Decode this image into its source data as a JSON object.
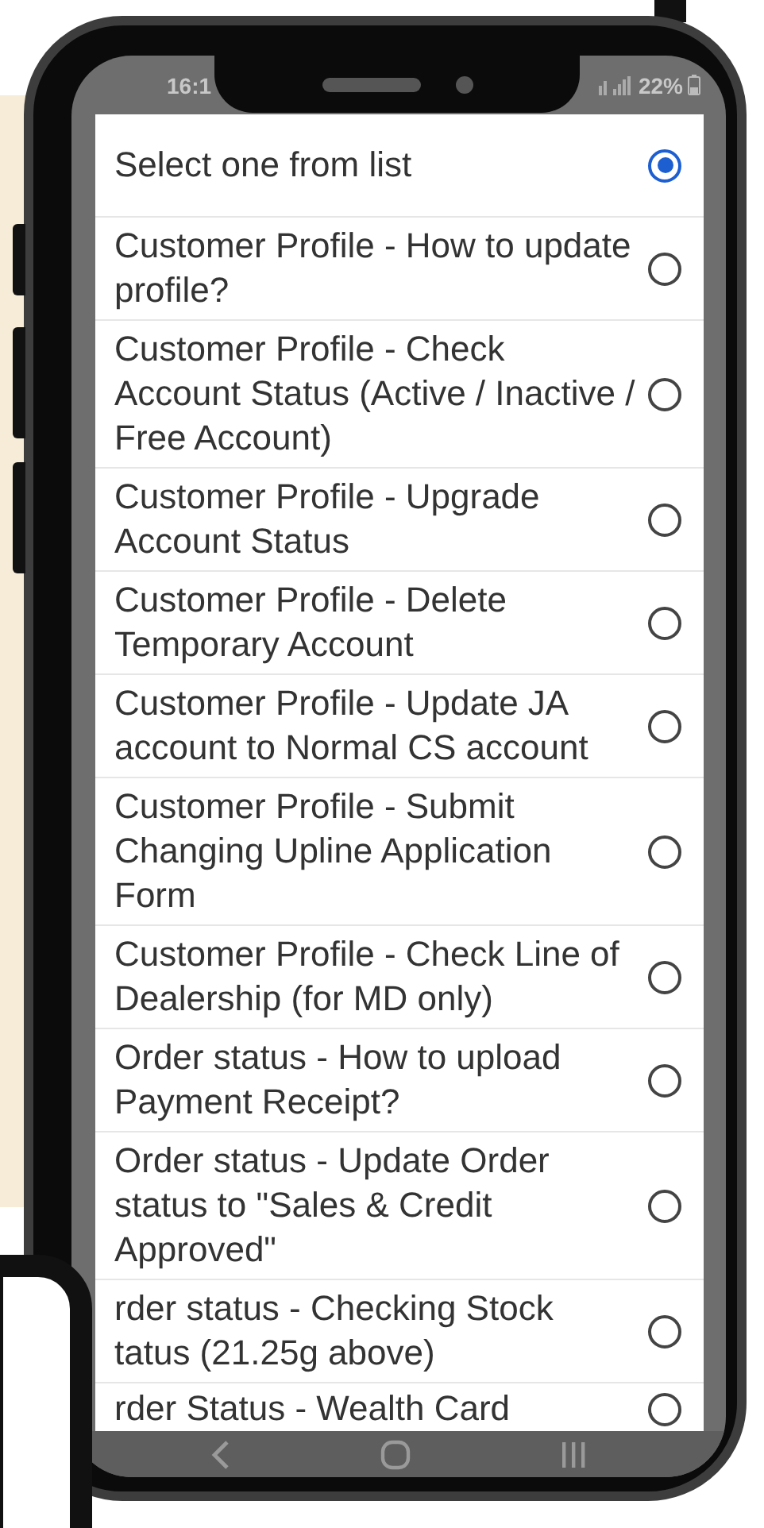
{
  "status_bar": {
    "time": "16:1",
    "battery": "22%"
  },
  "dialog": {
    "options": [
      {
        "label": "Select one from list",
        "selected": true
      },
      {
        "label": "Customer Profile - How to update profile?",
        "selected": false
      },
      {
        "label": "Customer Profile - Check Account Status (Active / Inactive / Free Account)",
        "selected": false
      },
      {
        "label": "Customer Profile - Upgrade Account Status",
        "selected": false
      },
      {
        "label": "Customer Profile - Delete Temporary Account",
        "selected": false
      },
      {
        "label": "Customer Profile - Update JA account to Normal CS account",
        "selected": false
      },
      {
        "label": "Customer Profile - Submit Changing Upline Application Form",
        "selected": false
      },
      {
        "label": "Customer Profile - Check Line of Dealership (for MD only)",
        "selected": false
      },
      {
        "label": "Order status - How to upload Payment Receipt?",
        "selected": false
      },
      {
        "label": "Order status - Update Order status to \"Sales & Credit Approved\"",
        "selected": false
      },
      {
        "label": "rder status - Checking Stock tatus (21.25g above)",
        "selected": false
      },
      {
        "label": "rder Status - Wealth Card",
        "selected": false
      }
    ]
  }
}
